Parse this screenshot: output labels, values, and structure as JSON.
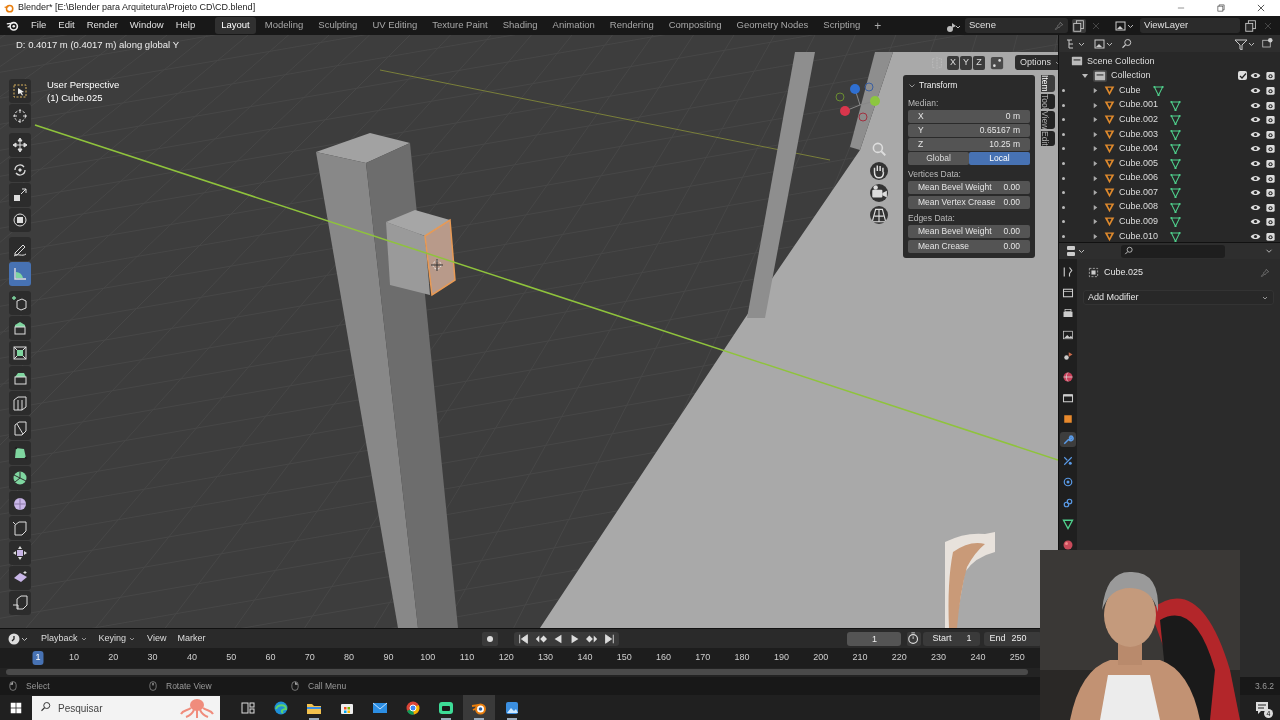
{
  "title_bar": {
    "title": "Blender* [E:\\Blender para Arquitetura\\Projeto CD\\CD.blend]"
  },
  "menu": [
    "File",
    "Edit",
    "Render",
    "Window",
    "Help"
  ],
  "workspaces": [
    {
      "label": "Layout",
      "selected": true
    },
    {
      "label": "Modeling",
      "selected": false
    },
    {
      "label": "Sculpting",
      "selected": false
    },
    {
      "label": "UV Editing",
      "selected": false
    },
    {
      "label": "Texture Paint",
      "selected": false
    },
    {
      "label": "Shading",
      "selected": false
    },
    {
      "label": "Animation",
      "selected": false
    },
    {
      "label": "Rendering",
      "selected": false
    },
    {
      "label": "Compositing",
      "selected": false
    },
    {
      "label": "Geometry Nodes",
      "selected": false
    },
    {
      "label": "Scripting",
      "selected": false
    }
  ],
  "add_workspace": "+",
  "scene": "Scene",
  "view_layer": "ViewLayer",
  "viewport": {
    "header_status": "D: 0.4017 m (0.4017 m) along global Y",
    "view_name": "User Perspective",
    "active_object": "(1) Cube.025",
    "toolbar": {
      "groups": [
        [
          {
            "selected": false
          },
          {
            "selected": false
          }
        ],
        [
          {
            "selected": false
          },
          {
            "selected": false
          },
          {
            "selected": false
          },
          {
            "selected": false
          }
        ],
        [
          {
            "selected": false
          },
          {
            "selected": true
          }
        ],
        [
          {
            "selected": false
          },
          {
            "selected": false
          },
          {
            "selected": false
          },
          {
            "selected": false
          },
          {
            "selected": false
          },
          {
            "selected": false
          },
          {
            "selected": false
          },
          {
            "selected": false
          },
          {
            "selected": false
          },
          {
            "selected": false
          },
          {
            "selected": false
          },
          {
            "selected": false
          },
          {
            "selected": false
          }
        ]
      ]
    },
    "axis_toggles": [
      "X",
      "Y",
      "Z"
    ],
    "options": "Options",
    "n_panel": {
      "title": "Transform",
      "expanded": true,
      "median_label": "Median:",
      "median": [
        {
          "axis": "X",
          "value": "0 m"
        },
        {
          "axis": "Y",
          "value": "0.65167 m"
        },
        {
          "axis": "Z",
          "value": "10.25 m"
        }
      ],
      "space": [
        {
          "label": "Global",
          "selected": false
        },
        {
          "label": "Local",
          "selected": true
        }
      ],
      "sections": [
        {
          "title": "Vertices Data:",
          "fields": [
            {
              "label": "Mean Bevel Weight",
              "value": "0.00"
            },
            {
              "label": "Mean Vertex Crease",
              "value": "0.00"
            }
          ]
        },
        {
          "title": "Edges Data:",
          "fields": [
            {
              "label": "Mean Bevel Weight",
              "value": "0.00"
            },
            {
              "label": "Mean Crease",
              "value": "0.00"
            }
          ]
        }
      ]
    },
    "side_tabs": [
      {
        "label": "Item",
        "selected": true
      },
      {
        "label": "Tool",
        "selected": false
      },
      {
        "label": "View",
        "selected": false
      },
      {
        "label": "Edit",
        "selected": false
      }
    ]
  },
  "outliner": {
    "root": "Scene Collection",
    "collection": {
      "name": "Collection",
      "checked": true,
      "expanded": true,
      "children": [
        {
          "name": "Cube",
          "expanded": false
        },
        {
          "name": "Cube.001",
          "expanded": false
        },
        {
          "name": "Cube.002",
          "expanded": false
        },
        {
          "name": "Cube.003",
          "expanded": false
        },
        {
          "name": "Cube.004",
          "expanded": false
        },
        {
          "name": "Cube.005",
          "expanded": false
        },
        {
          "name": "Cube.006",
          "expanded": false
        },
        {
          "name": "Cube.007",
          "expanded": false
        },
        {
          "name": "Cube.008",
          "expanded": false
        },
        {
          "name": "Cube.009",
          "expanded": false
        },
        {
          "name": "Cube.010",
          "expanded": false
        }
      ]
    }
  },
  "properties": {
    "tabs": [
      {
        "selected": false
      },
      {
        "selected": false
      },
      {
        "selected": false
      },
      {
        "selected": false
      },
      {
        "selected": false
      },
      {
        "selected": false
      },
      {
        "selected": false
      },
      {
        "selected": false
      },
      {
        "selected": true
      },
      {
        "selected": false
      },
      {
        "selected": false
      },
      {
        "selected": false
      },
      {
        "selected": false
      },
      {
        "selected": false
      }
    ],
    "object": "Cube.025",
    "add_modifier": "Add Modifier"
  },
  "timeline": {
    "menus": [
      {
        "label": "Playback",
        "dropdown": true
      },
      {
        "label": "Keying",
        "dropdown": true
      },
      {
        "label": "View",
        "dropdown": false
      },
      {
        "label": "Marker",
        "dropdown": false
      }
    ],
    "current_frame": "1",
    "start_label": "Start",
    "start": "1",
    "end_label": "End",
    "end": "250",
    "ruler": [
      {
        "label": "1",
        "current": true
      },
      {
        "label": "10",
        "current": false
      },
      {
        "label": "20",
        "current": false
      },
      {
        "label": "30",
        "current": false
      },
      {
        "label": "40",
        "current": false
      },
      {
        "label": "50",
        "current": false
      },
      {
        "label": "60",
        "current": false
      },
      {
        "label": "70",
        "current": false
      },
      {
        "label": "80",
        "current": false
      },
      {
        "label": "90",
        "current": false
      },
      {
        "label": "100",
        "current": false
      },
      {
        "label": "110",
        "current": false
      },
      {
        "label": "120",
        "current": false
      },
      {
        "label": "130",
        "current": false
      },
      {
        "label": "140",
        "current": false
      },
      {
        "label": "150",
        "current": false
      },
      {
        "label": "160",
        "current": false
      },
      {
        "label": "170",
        "current": false
      },
      {
        "label": "180",
        "current": false
      },
      {
        "label": "190",
        "current": false
      },
      {
        "label": "200",
        "current": false
      },
      {
        "label": "210",
        "current": false
      },
      {
        "label": "220",
        "current": false
      },
      {
        "label": "230",
        "current": false
      },
      {
        "label": "240",
        "current": false
      },
      {
        "label": "250",
        "current": false
      }
    ]
  },
  "status_bar": {
    "hints": [
      "Select",
      "Rotate View",
      "Call Menu"
    ],
    "version": "3.6.2"
  },
  "taskbar": {
    "search_placeholder": "Pesquisar",
    "apps": [
      {
        "running": false,
        "selected": false
      },
      {
        "running": false,
        "selected": false
      },
      {
        "running": true,
        "selected": false
      },
      {
        "running": false,
        "selected": false
      },
      {
        "running": false,
        "selected": false
      },
      {
        "running": false,
        "selected": false
      },
      {
        "running": true,
        "selected": false
      },
      {
        "running": true,
        "selected": true
      },
      {
        "running": true,
        "selected": false
      }
    ],
    "notifications": "4"
  }
}
